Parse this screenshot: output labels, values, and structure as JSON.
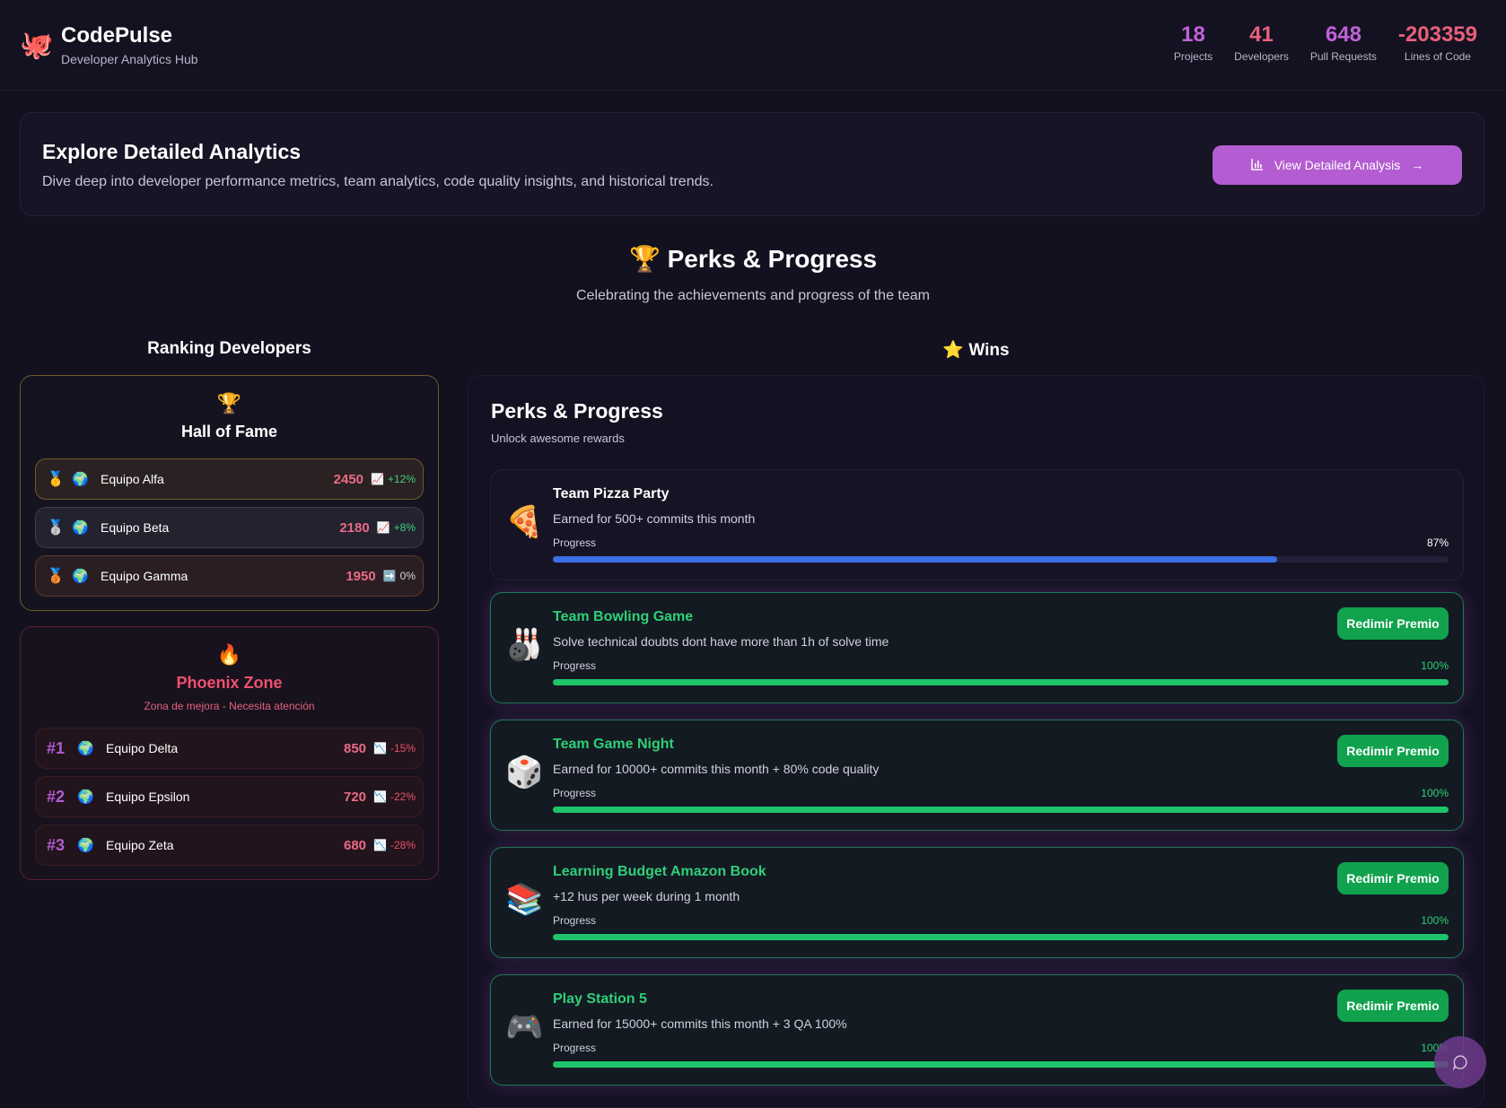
{
  "header": {
    "logo_icon": "octopus-icon",
    "title": "CodePulse",
    "subtitle": "Developer Analytics Hub",
    "stats": [
      {
        "value": "18",
        "label": "Projects"
      },
      {
        "value": "41",
        "label": "Developers"
      },
      {
        "value": "648",
        "label": "Pull Requests"
      },
      {
        "value": "-203359",
        "label": "Lines of Code"
      }
    ]
  },
  "explore": {
    "title": "Explore Detailed Analytics",
    "description": "Dive deep into developer performance metrics, team analytics, code quality insights, and historical trends.",
    "button_label": "View Detailed Analysis",
    "button_icon": "bar-chart-icon",
    "button_arrow": "arrow-right-icon"
  },
  "section": {
    "title": "🏆 Perks & Progress",
    "subtitle": "Celebrating the achievements and progress of the team"
  },
  "ranking": {
    "column_title": "Ranking Developers",
    "hall_of_fame": {
      "icon": "🏆",
      "title": "Hall of Fame",
      "rows": [
        {
          "medal": "🥇",
          "name": "Equipo Alfa",
          "score": "2450",
          "trend_icon": "📈",
          "change": "+12%"
        },
        {
          "medal": "🥈",
          "name": "Equipo Beta",
          "score": "2180",
          "trend_icon": "📈",
          "change": "+8%"
        },
        {
          "medal": "🥉",
          "name": "Equipo Gamma",
          "score": "1950",
          "trend_icon": "➡️",
          "change": "0%"
        }
      ]
    },
    "phoenix_zone": {
      "icon": "🔥",
      "title": "Phoenix Zone",
      "note": "Zona de mejora - Necesita atención",
      "rows": [
        {
          "rank": "#1",
          "name": "Equipo Delta",
          "score": "850",
          "trend_icon": "📉",
          "change": "-15%"
        },
        {
          "rank": "#2",
          "name": "Equipo Epsilon",
          "score": "720",
          "trend_icon": "📉",
          "change": "-22%"
        },
        {
          "rank": "#3",
          "name": "Equipo Zeta",
          "score": "680",
          "trend_icon": "📉",
          "change": "-28%"
        }
      ]
    }
  },
  "wins": {
    "column_title": "⭐ Wins",
    "title": "Perks & Progress",
    "subtitle": "Unlock awesome rewards",
    "progress_label": "Progress",
    "redeem_label": "Redimir Premio",
    "perks": [
      {
        "icon": "🍕",
        "title": "Team Pizza Party",
        "description": "Earned for 500+ commits this month",
        "percent_label": "87%",
        "progress": 0.87,
        "completed": false
      },
      {
        "icon": "🎳",
        "title": "Team Bowling Game",
        "description": "Solve technical doubts dont have more than 1h of solve time",
        "percent_label": "100%",
        "progress": 1.0,
        "completed": true
      },
      {
        "icon": "🎲",
        "title": "Team Game Night",
        "description": "Earned for 10000+ commits this month + 80% code quality",
        "percent_label": "100%",
        "progress": 1.0,
        "completed": true
      },
      {
        "icon": "📚",
        "title": "Learning Budget Amazon Book",
        "description": "+12 hus per week during 1 month",
        "percent_label": "100%",
        "progress": 1.0,
        "completed": true
      },
      {
        "icon": "🎮",
        "title": "Play Station 5",
        "description": "Earned for 15000+ commits this month + 3 QA 100%",
        "percent_label": "100%",
        "progress": 1.0,
        "completed": true
      }
    ]
  },
  "chat": {
    "icon": "chat-bubble-icon",
    "glyph": "💬"
  },
  "colors": {
    "background": "#13111f",
    "accent_purple": "#b45cd1",
    "success_green": "#1ec46a",
    "progress_blue": "#3b6fe6",
    "danger_red": "#f0506e"
  }
}
